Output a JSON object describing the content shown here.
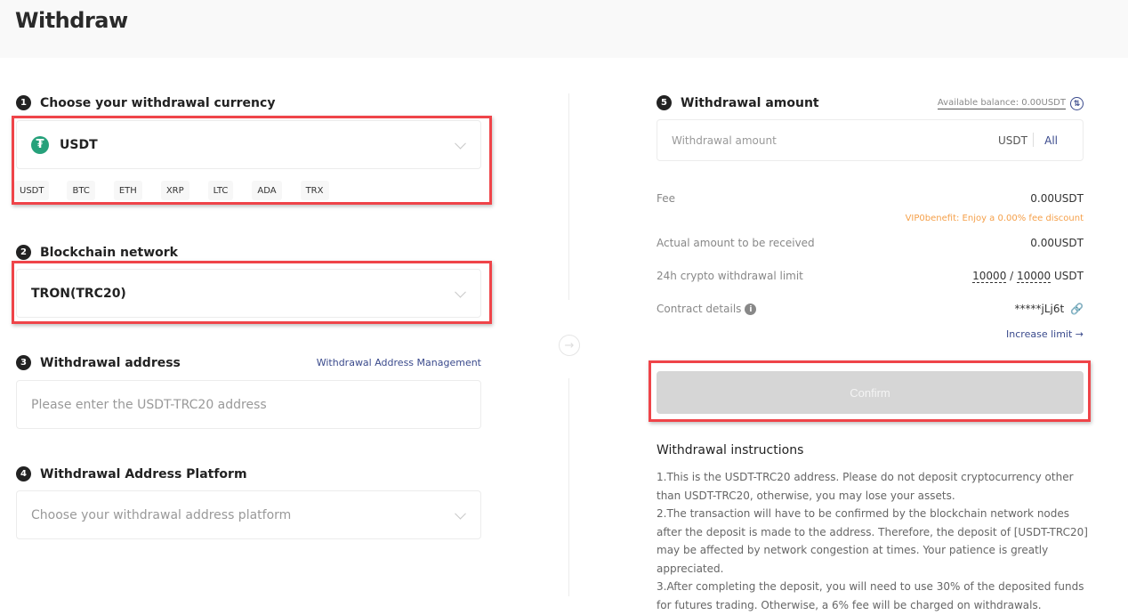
{
  "header": {
    "title": "Withdraw"
  },
  "steps": {
    "currency": {
      "number": "1",
      "label": "Choose your withdrawal currency",
      "selected": "USDT",
      "selected_icon": "tether-icon",
      "quick_picks": [
        "USDT",
        "BTC",
        "ETH",
        "XRP",
        "LTC",
        "ADA",
        "TRX"
      ]
    },
    "network": {
      "number": "2",
      "label": "Blockchain network",
      "selected": "TRON(TRC20)"
    },
    "address": {
      "number": "3",
      "label": "Withdrawal address",
      "manage_link": "Withdrawal Address Management",
      "placeholder": "Please enter the USDT-TRC20 address",
      "value": ""
    },
    "platform": {
      "number": "4",
      "label": "Withdrawal Address Platform",
      "placeholder": "Choose your withdrawal address platform"
    },
    "amount": {
      "number": "5",
      "label": "Withdrawal amount",
      "available_balance": "Available balance: 0.00USDT",
      "placeholder": "Withdrawal amount",
      "value": "",
      "unit": "USDT",
      "all_label": "All"
    }
  },
  "summary": {
    "fee_label": "Fee",
    "fee_value": "0.00USDT",
    "vip_note": "VIP0benefit: Enjoy a 0.00% fee discount",
    "received_label": "Actual amount to be received",
    "received_value": "0.00USDT",
    "limit_label": "24h crypto withdrawal limit",
    "limit_used": "10000",
    "limit_sep": " / ",
    "limit_total": "10000",
    "limit_unit": " USDT",
    "contract_label": "Contract details",
    "contract_value": "*****jLj6t",
    "increase_limit": "Increase limit →"
  },
  "confirm_label": "Confirm",
  "instructions": {
    "title": "Withdrawal instructions",
    "lines": [
      "1.This is the USDT-TRC20 address. Please do not deposit cryptocurrency other than USDT-TRC20, otherwise, you may lose your assets.",
      "2.The transaction will have to be confirmed by the blockchain network nodes after the deposit is made to the address. Therefore, the deposit of [USDT-TRC20] may be affected by network congestion at times. Your patience is greatly appreciated.",
      "3.After completing the deposit, you will need to use 30% of the deposited funds for futures trading. Otherwise, a 6% fee will be charged on withdrawals."
    ]
  },
  "colors": {
    "accent_link": "#3a4a8c",
    "vip_orange": "#f5a04a",
    "highlight_red": "#ef4449",
    "tether_green": "#26a17b",
    "disabled_button": "#d6d6d6"
  }
}
